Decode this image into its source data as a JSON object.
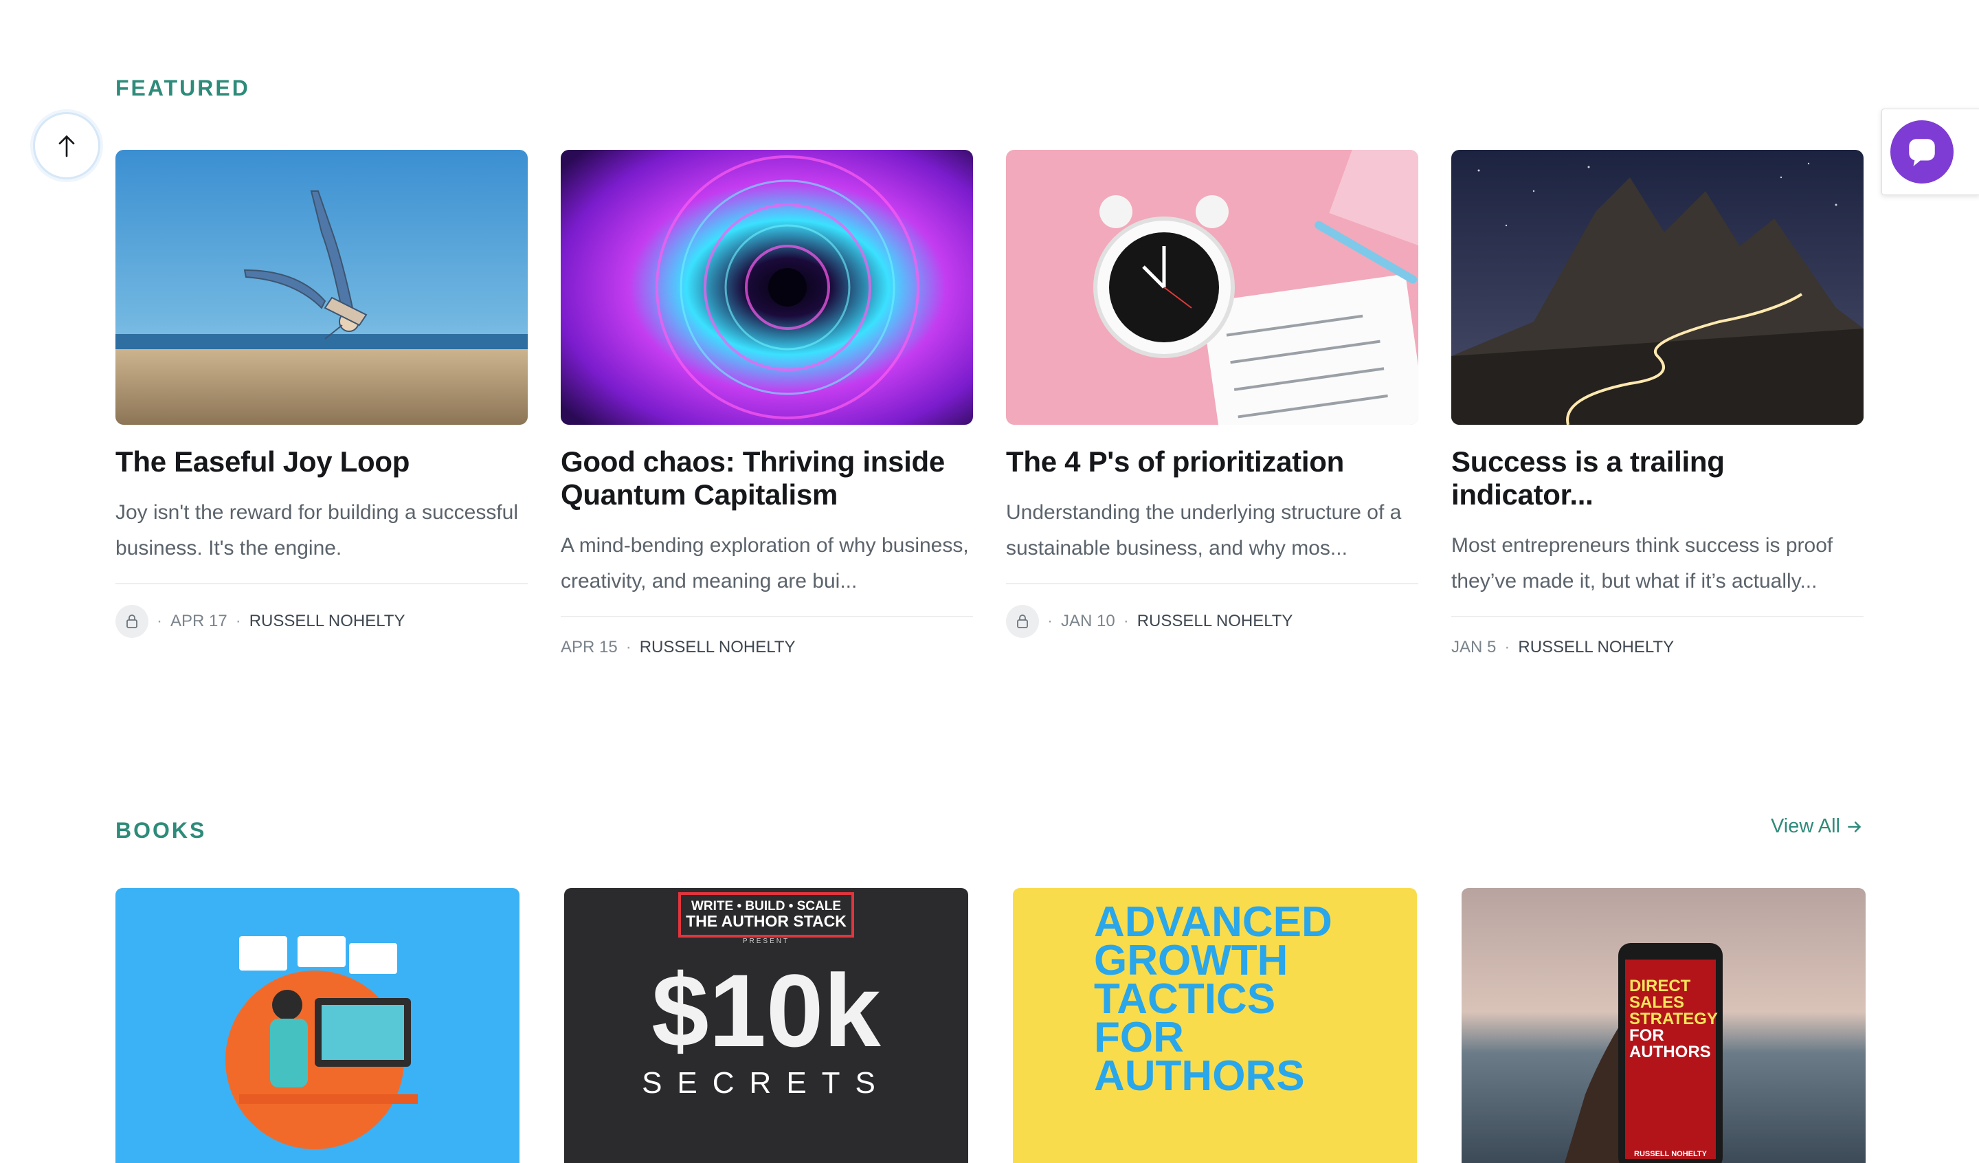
{
  "featured": {
    "label": "FEATURED",
    "posts": [
      {
        "title": "The Easeful Joy Loop",
        "excerpt": "Joy isn't the reward for building a successful business. It's the engine.",
        "date": "APR 17",
        "author": "RUSSELL NOHELTY",
        "locked": true
      },
      {
        "title": "Good chaos: Thriving inside Quantum Capitalism",
        "excerpt": "A mind-bending exploration of why business, creativity, and meaning are bui...",
        "date": "APR 15",
        "author": "RUSSELL NOHELTY",
        "locked": false
      },
      {
        "title": "The 4 P's of prioritization",
        "excerpt": "Understanding the underlying structure of a sustainable business, and why mos...",
        "date": "JAN 10",
        "author": "RUSSELL NOHELTY",
        "locked": true
      },
      {
        "title": "Success is a trailing indicator...",
        "excerpt": "Most entrepreneurs think success is proof they’ve made it, but what if it’s actually...",
        "date": "JAN 5",
        "author": "RUSSELL NOHELTY",
        "locked": false
      }
    ]
  },
  "books": {
    "label": "BOOKS",
    "view_all": "View All",
    "covers": [
      {
        "lines": []
      },
      {
        "lines": [
          "WRITE • BUILD • SCALE",
          "THE AUTHOR STACK",
          "PRESENT",
          "$10k",
          "SECRETS"
        ]
      },
      {
        "lines": [
          "ADVANCED",
          "GROWTH",
          "TACTICS",
          "FOR",
          "AUTHORS"
        ]
      },
      {
        "lines": [
          "DIRECT",
          "SALES",
          "STRATEGY",
          "FOR",
          "AUTHORS",
          "RUSSELL NOHELTY"
        ]
      }
    ]
  },
  "icons": {
    "scroll_top": "arrow-up-icon",
    "lock": "lock-icon",
    "chat": "chat-bubble-icon",
    "view_all": "arrow-right-icon"
  },
  "colors": {
    "accent": "#2e8b7a",
    "chat": "#7e3cd4"
  }
}
